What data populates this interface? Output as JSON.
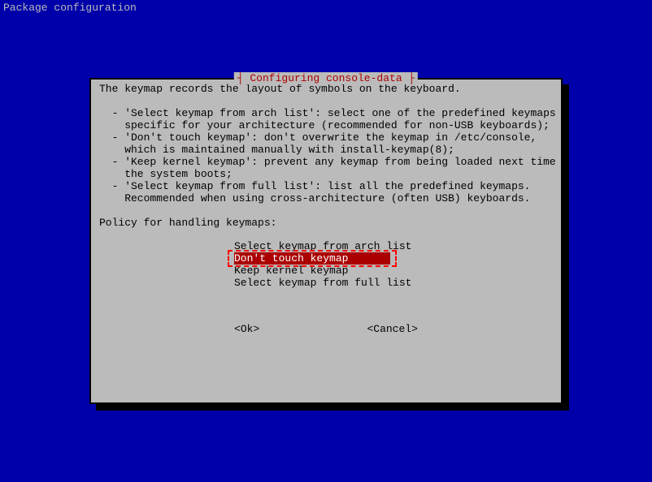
{
  "header": "Package configuration",
  "dialog": {
    "title": "┤ Configuring console-data ├",
    "description": "The keymap records the layout of symbols on the keyboard.\n\n  - 'Select keymap from arch list': select one of the predefined keymaps\n    specific for your architecture (recommended for non-USB keyboards);\n  - 'Don't touch keymap': don't overwrite the keymap in /etc/console,\n    which is maintained manually with install-keymap(8);\n  - 'Keep kernel keymap': prevent any keymap from being loaded next time\n    the system boots;\n  - 'Select keymap from full list': list all the predefined keymaps.\n    Recommended when using cross-architecture (often USB) keyboards.\n\nPolicy for handling keymaps:",
    "options": [
      "Select keymap from arch list",
      "Don't touch keymap",
      "Keep kernel keymap",
      "Select keymap from full list"
    ],
    "selectedIndex": 1,
    "buttons": {
      "ok": "<Ok>",
      "cancel": "<Cancel>"
    }
  }
}
